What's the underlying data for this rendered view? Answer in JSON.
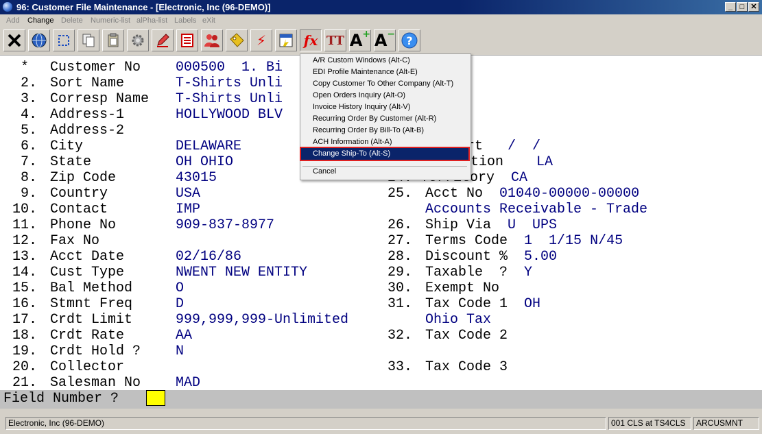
{
  "window": {
    "title": "96: Customer File Maintenance - [Electronic, Inc (96-DEMO)]",
    "minimize_glyph": "_",
    "restore_glyph": "□",
    "close_glyph": "✕"
  },
  "menubar": {
    "items": [
      {
        "label": "Add",
        "enabled": false
      },
      {
        "label": "Change",
        "enabled": true
      },
      {
        "label": "Delete",
        "enabled": false
      },
      {
        "label": "Numeric-list",
        "enabled": false
      },
      {
        "label": "alPha-list",
        "enabled": false
      },
      {
        "label": "Labels",
        "enabled": false
      },
      {
        "label": "eXit",
        "enabled": false
      }
    ]
  },
  "toolbar": {
    "icons": [
      "close-x-icon",
      "globe-icon",
      "select-icon",
      "copy-icon",
      "paste-icon",
      "settings-gear-icon",
      "edit-pencil-icon",
      "list-icon",
      "users-icon",
      "tag-icon",
      "lightning-icon",
      "notes-icon",
      "function-fx-icon",
      "text-style-icon",
      "font-increase-icon",
      "font-decrease-icon",
      "help-icon"
    ],
    "glyphs": {
      "fx": "fx",
      "tt": "TT",
      "a_plus": "A",
      "a_minus": "A",
      "help": "?",
      "close": "✕",
      "lightning": "⚡"
    }
  },
  "form": {
    "left": [
      {
        "num": " *",
        "label": "Customer No",
        "value": "000500  1. Bi"
      },
      {
        "num": " 2.",
        "label": "Sort Name",
        "value": "T-Shirts Unli"
      },
      {
        "num": " 3.",
        "label": "Corresp Name",
        "value": "T-Shirts Unli"
      },
      {
        "num": " 4.",
        "label": "Address-1",
        "value": "HOLLYWOOD BLV"
      },
      {
        "num": " 5.",
        "label": "Address-2",
        "value": ""
      },
      {
        "num": " 6.",
        "label": "City",
        "value": "DELAWARE"
      },
      {
        "num": " 7.",
        "label": "State",
        "value": "OH OHIO"
      },
      {
        "num": " 8.",
        "label": "Zip Code",
        "value": "43015"
      },
      {
        "num": " 9.",
        "label": "Country",
        "value": "USA"
      },
      {
        "num": "10.",
        "label": "Contact",
        "value": "IMP"
      },
      {
        "num": "11.",
        "label": "Phone No",
        "value": "909-837-8977"
      },
      {
        "num": "12.",
        "label": "Fax No",
        "value": ""
      },
      {
        "num": "13.",
        "label": "Acct Date",
        "value": "02/16/86"
      },
      {
        "num": "14.",
        "label": "Cust Type",
        "value": "NWENT NEW ENTITY"
      },
      {
        "num": "15.",
        "label": "Bal Method",
        "value": "O"
      },
      {
        "num": "16.",
        "label": "Stmnt Freq",
        "value": "D"
      },
      {
        "num": "17.",
        "label": "Crdt Limit",
        "value": "999,999,999-Unlimited"
      },
      {
        "num": "18.",
        "label": "Crdt Rate",
        "value": "AA"
      },
      {
        "num": "19.",
        "label": "Crdt Hold ?",
        "value": "N"
      },
      {
        "num": "20.",
        "label": "Collector",
        "value": ""
      },
      {
        "num": "21.",
        "label": "Salesman No",
        "value": "MAD"
      }
    ],
    "right_partial": [
      {
        "label": "n Start",
        "value": "/  /"
      },
      {
        "label": "tion",
        "value": "LA"
      },
      {
        "label": "24. Territory",
        "value": "CA"
      }
    ],
    "right": [
      {
        "num": "25.",
        "label": "Acct No",
        "value": "01040-00000-00000"
      },
      {
        "num": "",
        "label": "",
        "value": "Accounts Receivable - Trade"
      },
      {
        "num": "26.",
        "label": "Ship Via",
        "value": "U  UPS"
      },
      {
        "num": "27.",
        "label": "Terms Code",
        "value": "1  1/15 N/45"
      },
      {
        "num": "28.",
        "label": "Discount %",
        "value": "5.00"
      },
      {
        "num": "29.",
        "label": "Taxable  ?",
        "value": "Y"
      },
      {
        "num": "30.",
        "label": "Exempt No",
        "value": ""
      },
      {
        "num": "31.",
        "label": "Tax Code 1",
        "value": "OH"
      },
      {
        "num": "",
        "label": "",
        "value": "Ohio Tax"
      },
      {
        "num": "32.",
        "label": "Tax Code 2",
        "value": ""
      },
      {
        "num": "33.",
        "label": "Tax Code 3",
        "value": ""
      }
    ]
  },
  "prompt": {
    "label": "Field Number ?",
    "value": ""
  },
  "popup_menu": {
    "items": [
      "A/R Custom Windows  (Alt-C)",
      "EDI Profile Maintenance  (Alt-E)",
      "Copy Customer To Other Company  (Alt-T)",
      "Open Orders Inquiry  (Alt-O)",
      "Invoice History Inquiry  (Alt-V)",
      "Recurring Order By Customer  (Alt-R)",
      "Recurring Order By Bill-To  (Alt-B)",
      "ACH Information  (Alt-A)",
      "Change Ship-To  (Alt-S)"
    ],
    "selected_index": 8,
    "cancel": "Cancel"
  },
  "statusbar": {
    "company": "Electronic, Inc (96-DEMO)",
    "session": "001 CLS at TS4CLS",
    "program": "ARCUSMNT"
  },
  "colors": {
    "title_bar": "#0a246a",
    "field_value": "#000080",
    "prompt_box": "#ffff00",
    "selection_outline": "#e02020"
  }
}
